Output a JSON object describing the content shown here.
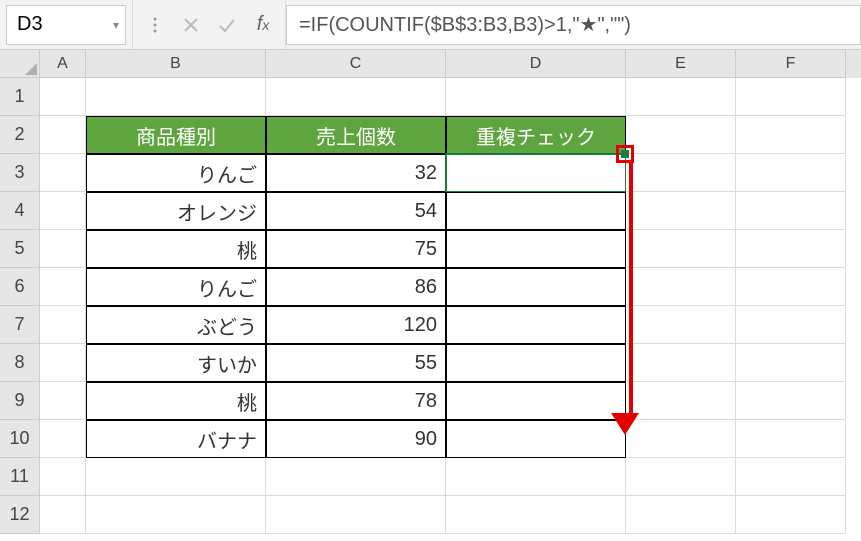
{
  "name_box": "D3",
  "formula": "=IF(COUNTIF($B$3:B3,B3)>1,\"★\",\"\")",
  "columns": [
    "",
    "A",
    "B",
    "C",
    "D",
    "E",
    "F"
  ],
  "row_numbers": [
    "1",
    "2",
    "3",
    "4",
    "5",
    "6",
    "7",
    "8",
    "9",
    "10",
    "11",
    "12"
  ],
  "header_row": {
    "b": "商品種別",
    "c": "売上個数",
    "d": "重複チェック"
  },
  "data_rows": [
    {
      "b": "りんご",
      "c": "32",
      "d": ""
    },
    {
      "b": "オレンジ",
      "c": "54",
      "d": ""
    },
    {
      "b": "桃",
      "c": "75",
      "d": ""
    },
    {
      "b": "りんご",
      "c": "86",
      "d": ""
    },
    {
      "b": "ぶどう",
      "c": "120",
      "d": ""
    },
    {
      "b": "すいか",
      "c": "55",
      "d": ""
    },
    {
      "b": "桃",
      "c": "78",
      "d": ""
    },
    {
      "b": "バナナ",
      "c": "90",
      "d": ""
    }
  ],
  "chart_data": {
    "type": "table",
    "title": "",
    "columns": [
      "商品種別",
      "売上個数",
      "重複チェック"
    ],
    "rows": [
      [
        "りんご",
        32,
        ""
      ],
      [
        "オレンジ",
        54,
        ""
      ],
      [
        "桃",
        75,
        ""
      ],
      [
        "りんご",
        86,
        ""
      ],
      [
        "ぶどう",
        120,
        ""
      ],
      [
        "すいか",
        55,
        ""
      ],
      [
        "桃",
        78,
        ""
      ],
      [
        "バナナ",
        90,
        ""
      ]
    ]
  }
}
